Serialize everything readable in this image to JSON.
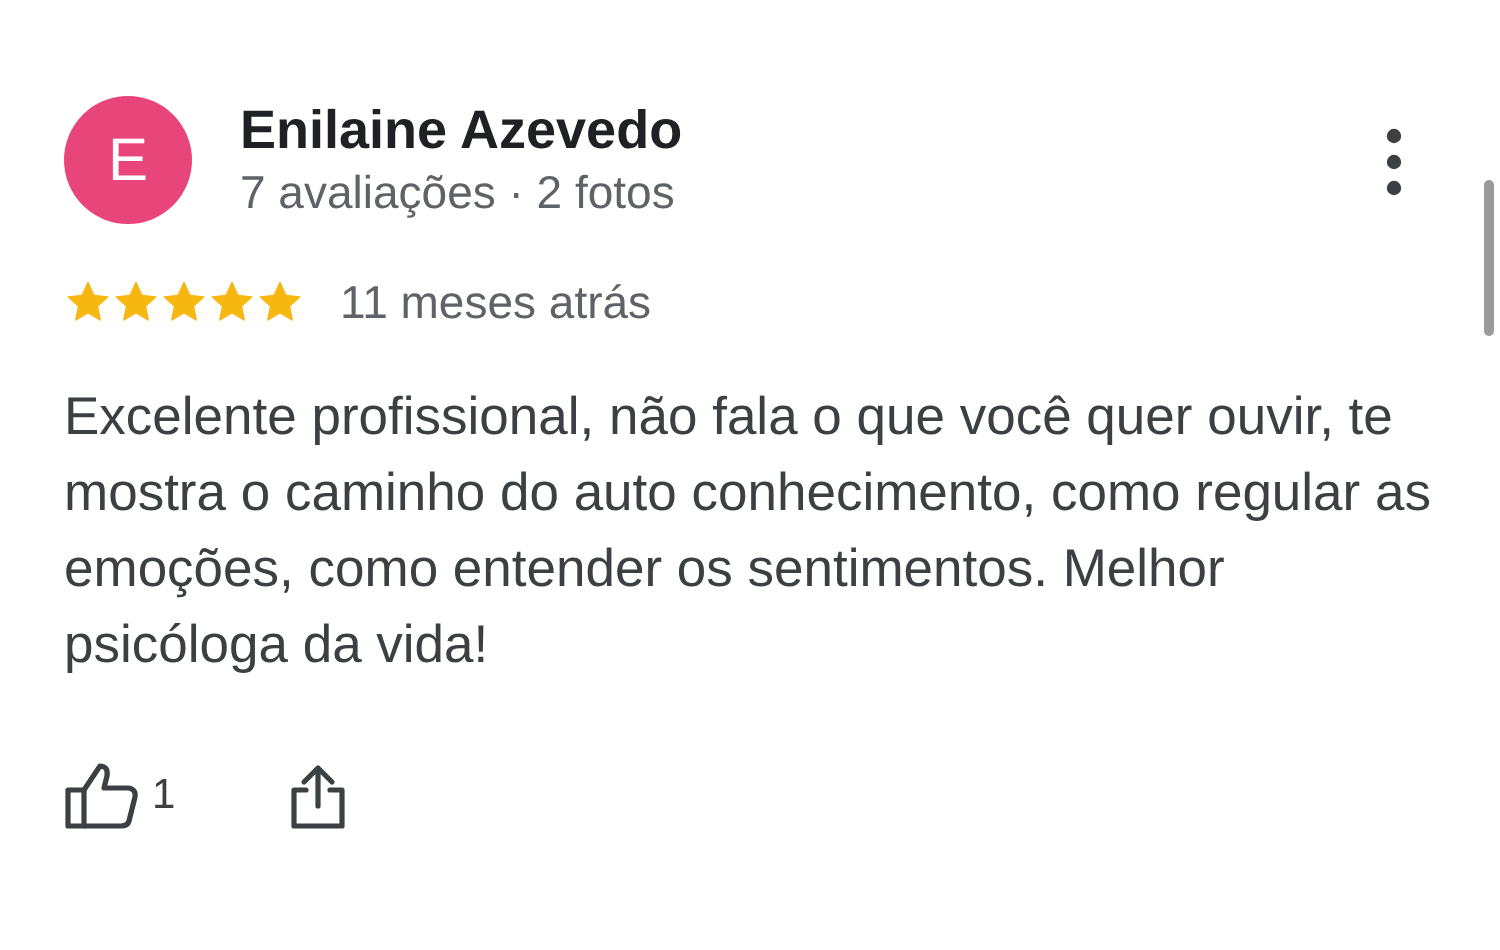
{
  "review": {
    "avatar_letter": "E",
    "author": "Enilaine Azevedo",
    "author_meta": "7 avaliações · 2 fotos",
    "stars": 5,
    "time": "11 meses atrás",
    "text": "Excelente profissional, não fala o que você quer ouvir, te mostra o caminho do auto conhecimento, como regular as emoções, como entender os sentimentos. Melhor psicóloga da vida!",
    "like_count": "1"
  }
}
